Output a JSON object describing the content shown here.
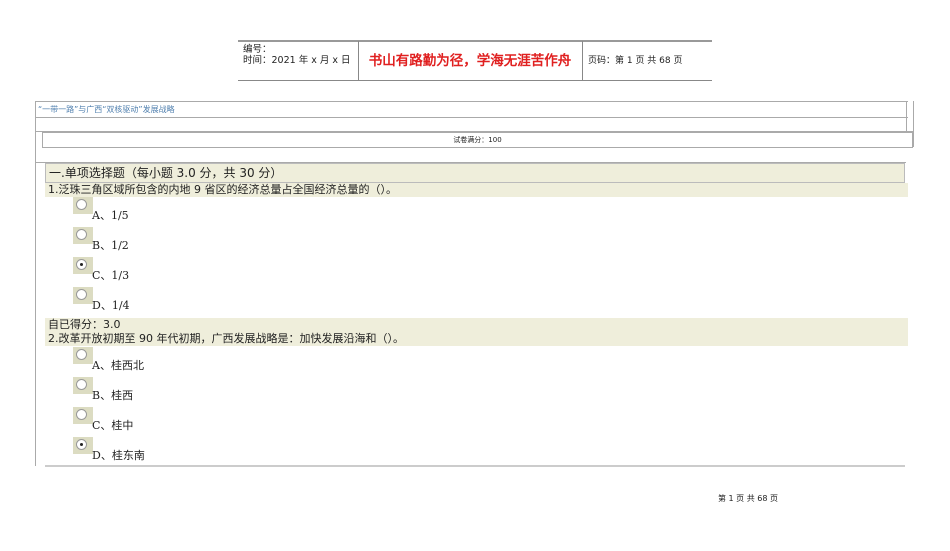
{
  "header": {
    "number_label": "编号：",
    "time_label": "时间：2021 年 x 月 x 日",
    "motto": "书山有路勤为径，学海无涯苦作舟",
    "page_label": "页码：第 1 页  共 68 页"
  },
  "course_title": "“一带一路”与广西“双核驱动”发展战略",
  "full_score": "试卷满分：100",
  "section_title": "一.单项选择题（每小题 3.0 分，共 30 分）",
  "questions": [
    {
      "text": "1.泛珠三角区域所包含的内地 9 省区的经济总量占全国经济总量的（）。",
      "options": [
        {
          "label": "A、1/5",
          "checked": false
        },
        {
          "label": "B、1/2",
          "checked": false
        },
        {
          "label": "C、1/3",
          "checked": true
        },
        {
          "label": "D、1/4",
          "checked": false
        }
      ],
      "score": "自已得分：3.0"
    },
    {
      "text": "2.改革开放初期至 90 年代初期，广西发展战略是：加快发展沿海和（）。",
      "options": [
        {
          "label": "A、桂西北",
          "checked": false
        },
        {
          "label": "B、桂西",
          "checked": false
        },
        {
          "label": "C、桂中",
          "checked": false
        },
        {
          "label": "D、桂东南",
          "checked": true
        }
      ]
    }
  ],
  "footer": "第 1 页 共 68 页"
}
